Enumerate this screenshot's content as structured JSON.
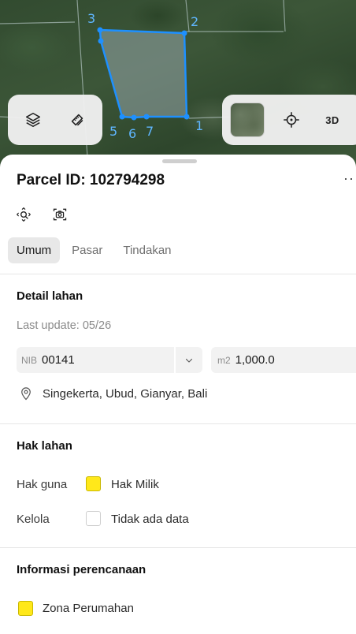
{
  "map": {
    "vertex_labels": [
      "1",
      "2",
      "3",
      "5",
      "6",
      "7"
    ],
    "parcel_color": "#1e90ff",
    "map_toolbar_left": {
      "layers_icon": "layers-icon",
      "measure_icon": "ruler-pencil-icon"
    },
    "map_toolbar_right": {
      "basemap_icon": "satellite-thumbnail",
      "locate_icon": "crosshair-icon",
      "three_d_label": "3D"
    }
  },
  "sheet": {
    "title": "Parcel ID: 102794298",
    "more_label": "···",
    "tools": [
      "zoom-to-parcel-icon",
      "screenshot-icon"
    ],
    "tabs": [
      {
        "label": "Umum",
        "active": true
      },
      {
        "label": "Pasar",
        "active": false
      },
      {
        "label": "Tindakan",
        "active": false
      }
    ],
    "detail": {
      "title": "Detail lahan",
      "last_update": "Last update: 05/26",
      "nib_prefix": "NIB",
      "nib_value": "00141",
      "area_prefix": "m2",
      "area_value": "1,000.0",
      "location": "Singekerta, Ubud, Gianyar, Bali"
    },
    "rights": {
      "title": "Hak lahan",
      "rows": [
        {
          "label": "Hak guna",
          "value": "Hak Milik",
          "color": "#ffe81a"
        },
        {
          "label": "Kelola",
          "value": "Tidak ada data",
          "color": "#ffffff"
        }
      ]
    },
    "planning": {
      "title": "Informasi perencanaan",
      "zone": "Zona Perumahan",
      "zone_color": "#ffe81a"
    }
  }
}
